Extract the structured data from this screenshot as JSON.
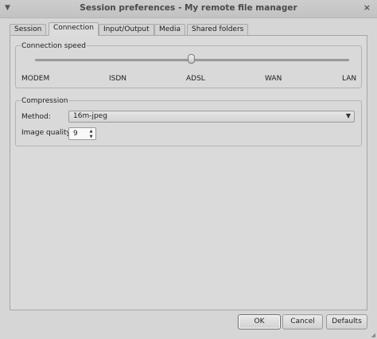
{
  "window": {
    "title": "Session preferences - My remote file manager",
    "menu_icon": "chevron-down-icon",
    "close_icon": "close-icon",
    "close_glyph": "×"
  },
  "tabs": [
    {
      "label": "Session",
      "active": false
    },
    {
      "label": "Connection",
      "active": true
    },
    {
      "label": "Input/Output",
      "active": false
    },
    {
      "label": "Media",
      "active": false
    },
    {
      "label": "Shared folders",
      "active": false
    }
  ],
  "connection_speed": {
    "label": "Connection speed",
    "ticks": [
      "MODEM",
      "ISDN",
      "ADSL",
      "WAN",
      "LAN"
    ],
    "selected_index": 2,
    "selected_value": "ADSL"
  },
  "compression": {
    "label": "Compression",
    "method_label": "Method:",
    "method_value": "16m-jpeg",
    "quality_label": "Image quality:",
    "quality_value": "9"
  },
  "buttons": {
    "ok": "OK",
    "cancel": "Cancel",
    "defaults": "Defaults"
  }
}
